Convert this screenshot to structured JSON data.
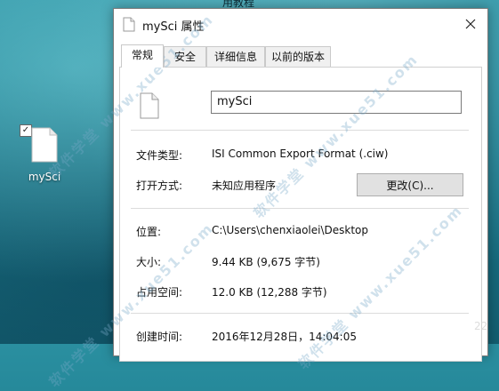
{
  "desktop": {
    "top_partial_text": "用教程",
    "icon": {
      "label": "mySci",
      "checked": true
    },
    "corner_number": "22"
  },
  "dialog": {
    "title": "mySci 属性",
    "tabs": [
      {
        "label": "常规",
        "active": true
      },
      {
        "label": "安全",
        "active": false
      },
      {
        "label": "详细信息",
        "active": false
      },
      {
        "label": "以前的版本",
        "active": false
      }
    ],
    "name_value": "mySci",
    "file_type_label": "文件类型:",
    "file_type_value": "ISI Common Export Format (.ciw)",
    "opens_with_label": "打开方式:",
    "opens_with_value": "未知应用程序",
    "change_button": "更改(C)...",
    "location_label": "位置:",
    "location_value": "C:\\Users\\chenxiaolei\\Desktop",
    "size_label": "大小:",
    "size_value": "9.44 KB (9,675 字节)",
    "size_on_disk_label": "占用空间:",
    "size_on_disk_value": "12.0 KB (12,288 字节)",
    "created_label": "创建时间:",
    "created_value": "2016年12月28日，14:04:05"
  },
  "watermark": "软件学堂 www.xue51.com"
}
